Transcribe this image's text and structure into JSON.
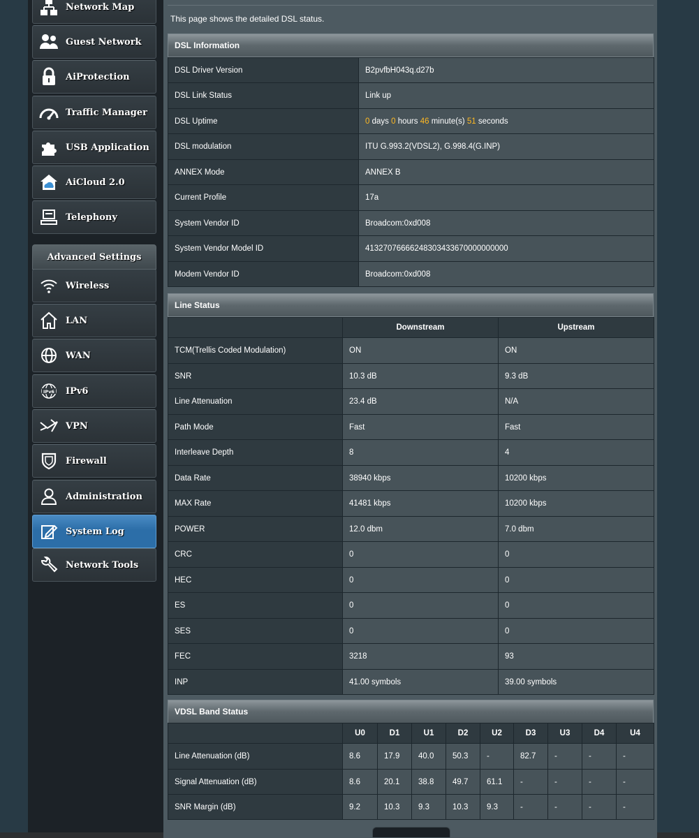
{
  "sidebar": {
    "items": [
      {
        "label": "Network Map",
        "icon": "network-map-icon"
      },
      {
        "label": "Guest Network",
        "icon": "guest-network-icon"
      },
      {
        "label": "AiProtection",
        "icon": "lock-icon"
      },
      {
        "label": "Traffic Manager",
        "icon": "gauge-icon"
      },
      {
        "label": "USB Application",
        "icon": "puzzle-icon"
      },
      {
        "label": "AiCloud 2.0",
        "icon": "cloud-home-icon"
      },
      {
        "label": "Telephony",
        "icon": "telephony-icon"
      }
    ],
    "advanced_header": "Advanced Settings",
    "advanced_items": [
      {
        "label": "Wireless",
        "icon": "wifi-icon"
      },
      {
        "label": "LAN",
        "icon": "home-icon"
      },
      {
        "label": "WAN",
        "icon": "globe-icon"
      },
      {
        "label": "IPv6",
        "icon": "ipv6-icon"
      },
      {
        "label": "VPN",
        "icon": "vpn-icon"
      },
      {
        "label": "Firewall",
        "icon": "shield-icon"
      },
      {
        "label": "Administration",
        "icon": "user-icon"
      },
      {
        "label": "System Log",
        "icon": "edit-log-icon",
        "active": true
      },
      {
        "label": "Network Tools",
        "icon": "tools-icon"
      }
    ]
  },
  "page": {
    "description": "This page shows the detailed DSL status."
  },
  "dsl_info": {
    "title": "DSL Information",
    "rows": [
      {
        "label": "DSL Driver Version",
        "value": "B2pvfbH043q.d27b"
      },
      {
        "label": "DSL Link Status",
        "value": "Link up"
      },
      {
        "label": "DSL Uptime",
        "uptime": {
          "days": "0",
          "days_unit": "days",
          "hours": "0",
          "hours_unit": "hours",
          "minutes": "46",
          "minutes_unit": "minute(s)",
          "seconds": "51",
          "seconds_unit": "seconds"
        }
      },
      {
        "label": "DSL modulation",
        "value": "ITU G.993.2(VDSL2), G.998.4(G.INP)"
      },
      {
        "label": "ANNEX Mode",
        "value": "ANNEX B"
      },
      {
        "label": "Current Profile",
        "value": "17a"
      },
      {
        "label": "System Vendor ID",
        "value": "Broadcom:0xd008"
      },
      {
        "label": "System Vendor Model ID",
        "value": "41327076666248303433670000000000"
      },
      {
        "label": "Modem Vendor ID",
        "value": "Broadcom:0xd008"
      }
    ]
  },
  "line_status": {
    "title": "Line Status",
    "headers": [
      "",
      "Downstream",
      "Upstream"
    ],
    "rows": [
      {
        "label": "TCM(Trellis Coded Modulation)",
        "down": "ON",
        "up": "ON"
      },
      {
        "label": "SNR",
        "down": "10.3 dB",
        "up": "9.3 dB"
      },
      {
        "label": "Line Attenuation",
        "down": "23.4 dB",
        "up": "N/A"
      },
      {
        "label": "Path Mode",
        "down": "Fast",
        "up": "Fast"
      },
      {
        "label": "Interleave Depth",
        "down": "8",
        "up": "4"
      },
      {
        "label": "Data Rate",
        "down": "38940 kbps",
        "up": "10200 kbps"
      },
      {
        "label": "MAX Rate",
        "down": "41481 kbps",
        "up": "10200 kbps"
      },
      {
        "label": "POWER",
        "down": "12.0 dbm",
        "up": "7.0 dbm"
      },
      {
        "label": "CRC",
        "down": "0",
        "up": "0"
      },
      {
        "label": "HEC",
        "down": "0",
        "up": "0"
      },
      {
        "label": "ES",
        "down": "0",
        "up": "0"
      },
      {
        "label": "SES",
        "down": "0",
        "up": "0"
      },
      {
        "label": "FEC",
        "down": "3218",
        "up": "93"
      },
      {
        "label": "INP",
        "down": "41.00 symbols",
        "up": "39.00 symbols"
      }
    ]
  },
  "vdsl_band": {
    "title": "VDSL Band Status",
    "bands": [
      "U0",
      "D1",
      "U1",
      "D2",
      "U2",
      "D3",
      "U3",
      "D4",
      "U4"
    ],
    "rows": [
      {
        "label": "Line Attenuation (dB)",
        "values": [
          "8.6",
          "17.9",
          "40.0",
          "50.3",
          "-",
          "82.7",
          "-",
          "-",
          "-"
        ]
      },
      {
        "label": "Signal Attenuation (dB)",
        "values": [
          "8.6",
          "20.1",
          "38.8",
          "49.7",
          "61.1",
          "-",
          "-",
          "-",
          "-"
        ]
      },
      {
        "label": "SNR Margin (dB)",
        "values": [
          "9.2",
          "10.3",
          "9.3",
          "10.3",
          "9.3",
          "-",
          "-",
          "-",
          "-"
        ]
      }
    ]
  },
  "colors": {
    "upstream_band": "#38b6e8",
    "downstream_band": "#f39a28",
    "highlight": "#ffb922",
    "active_menu": "#2c6ea8"
  }
}
